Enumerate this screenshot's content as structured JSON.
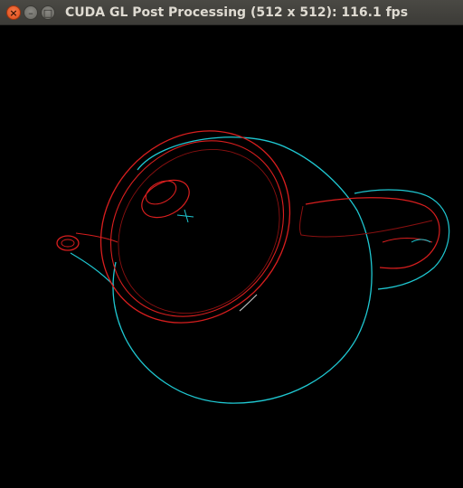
{
  "window": {
    "title": "CUDA GL Post Processing (512 x 512): 116.1 fps",
    "controls": {
      "close_glyph": "×",
      "minimize_glyph": "–",
      "maximize_glyph": "□"
    }
  },
  "viewport": {
    "background": "#000000",
    "object": "teapot",
    "edge_colors": {
      "silhouette": "#1fc8d2",
      "lid": "#d81e1e",
      "inner": "#8a1010"
    }
  }
}
